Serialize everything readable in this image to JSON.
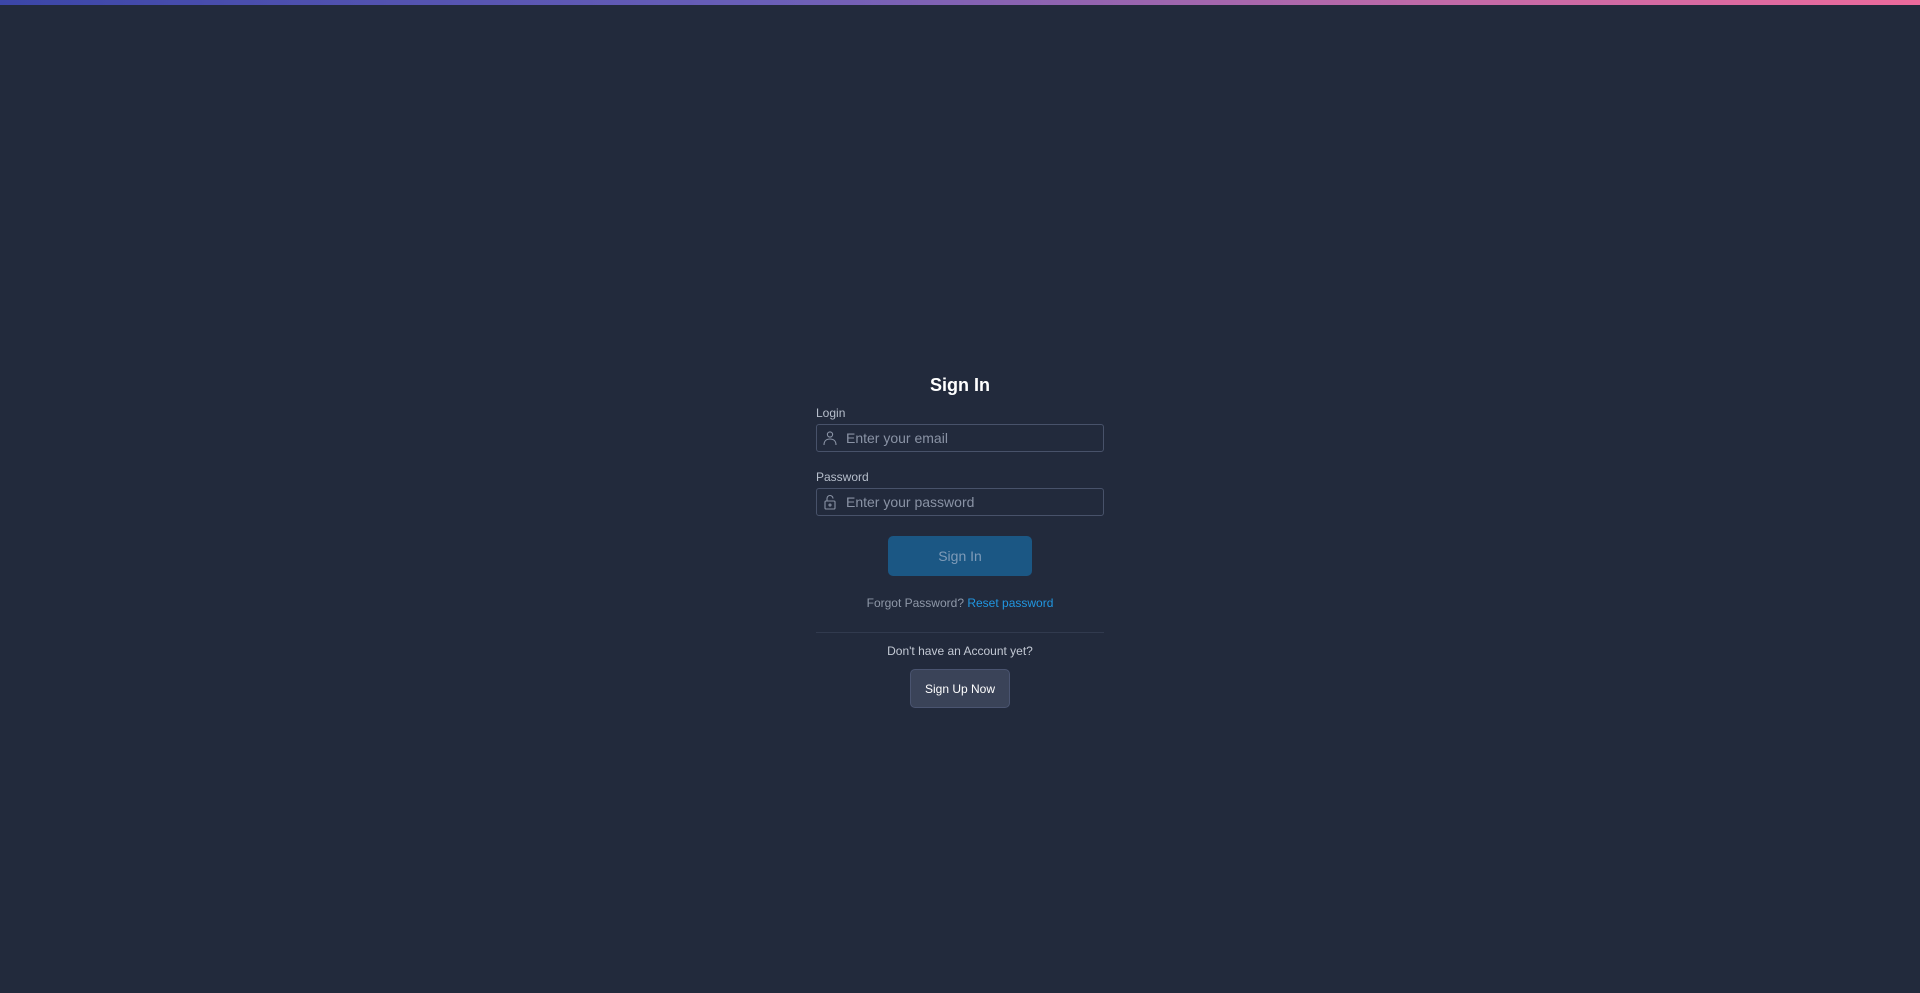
{
  "theme": {
    "background": "#222a3c",
    "accent": "#1b5784",
    "link": "#2196e0",
    "top_gradient": [
      "#3b46a8",
      "#ec6a9c"
    ]
  },
  "form": {
    "title": "Sign In",
    "login": {
      "label": "Login",
      "placeholder": "Enter your email",
      "value": "",
      "icon": "user-icon"
    },
    "password": {
      "label": "Password",
      "placeholder": "Enter your password",
      "value": "",
      "icon": "lock-icon"
    },
    "submit_label": "Sign In",
    "forgot_text": "Forgot Password?",
    "reset_link": "Reset password"
  },
  "signup": {
    "prompt": "Don't have an Account yet?",
    "button_label": "Sign Up Now"
  }
}
